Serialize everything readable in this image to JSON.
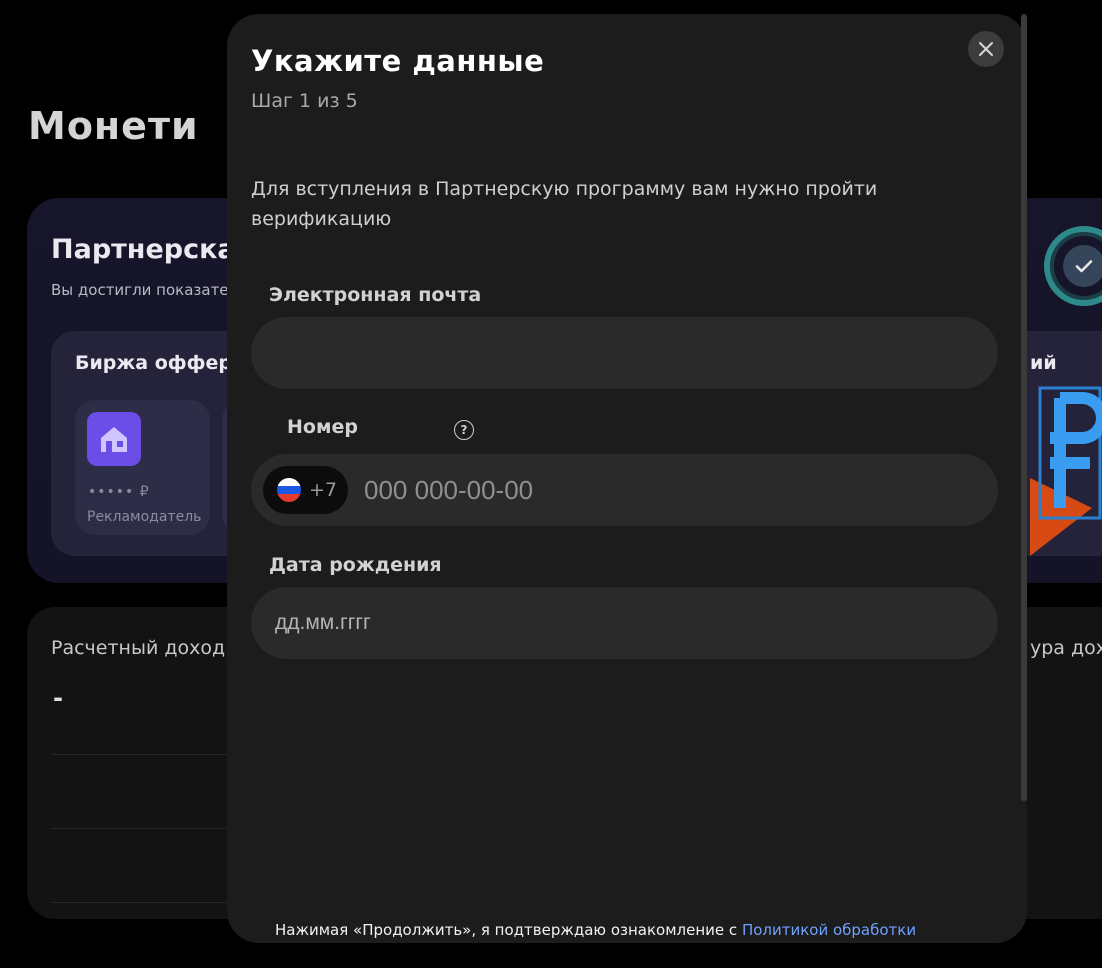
{
  "background": {
    "page_title": "Монети",
    "partner_card": {
      "title": "Партнерска",
      "subtitle": "Вы достигли показате"
    },
    "exchange": {
      "title": "Биржа офферо",
      "right_label": "ий",
      "advertiser": {
        "amount": "••••• ₽",
        "label": "Рекламодатель"
      }
    },
    "income": {
      "title": "Расчетный доход",
      "value": "-",
      "right_label": "ура дохо"
    }
  },
  "modal": {
    "title": "Укажите данные",
    "step": "Шаг 1 из 5",
    "description": "Для вступления в Партнерскую программу вам нужно пройти верификацию",
    "email": {
      "label": "Электронная почта",
      "value": "",
      "placeholder": ""
    },
    "phone": {
      "label": "Номер",
      "dial_code": "+7",
      "placeholder": "000 000-00-00",
      "flag_colors": [
        "#ffffff",
        "#1c57e6",
        "#e63a2e"
      ]
    },
    "birthdate": {
      "label": "Дата рождения",
      "placeholder": "дд.мм.гггг"
    },
    "consent": {
      "text": "Нажимая «Продолжить», я подтверждаю ознакомление с",
      "link": "Политикой обработки"
    }
  }
}
